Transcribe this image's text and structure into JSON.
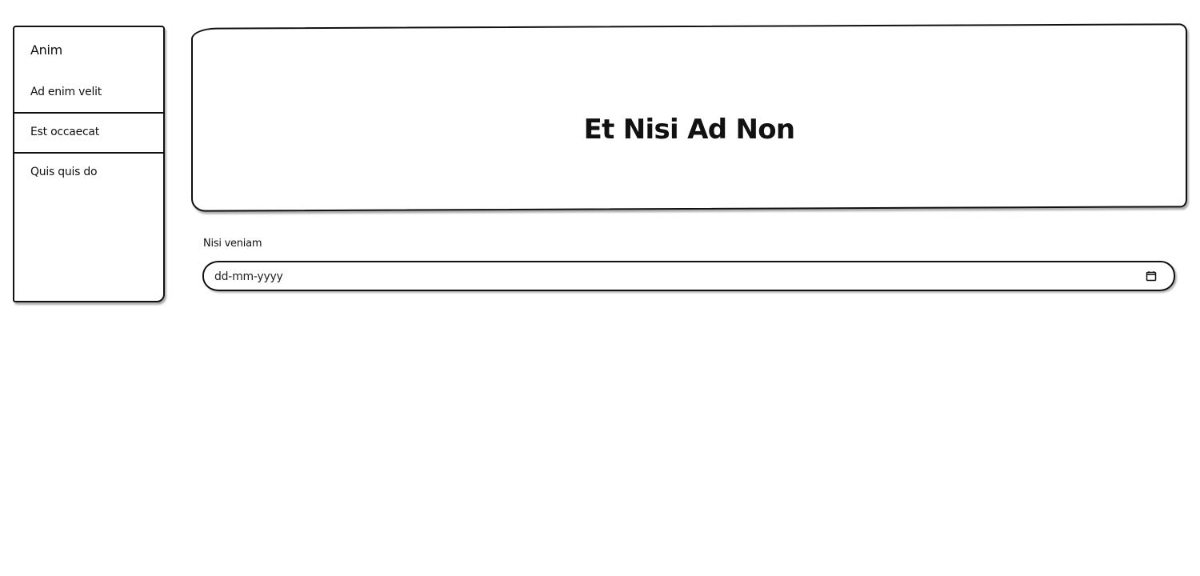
{
  "sidebar": {
    "title": "Anim",
    "items": [
      {
        "label": "Ad enim velit"
      },
      {
        "label": "Est occaecat"
      },
      {
        "label": "Quis quis do"
      }
    ]
  },
  "hero": {
    "title": "Et Nisi Ad Non"
  },
  "form": {
    "date_label": "Nisi veniam",
    "date_placeholder": "dd-mm-yyyy"
  },
  "icons": {
    "calendar": "calendar-icon"
  },
  "colors": {
    "ink": "#111111",
    "background": "#ffffff"
  }
}
